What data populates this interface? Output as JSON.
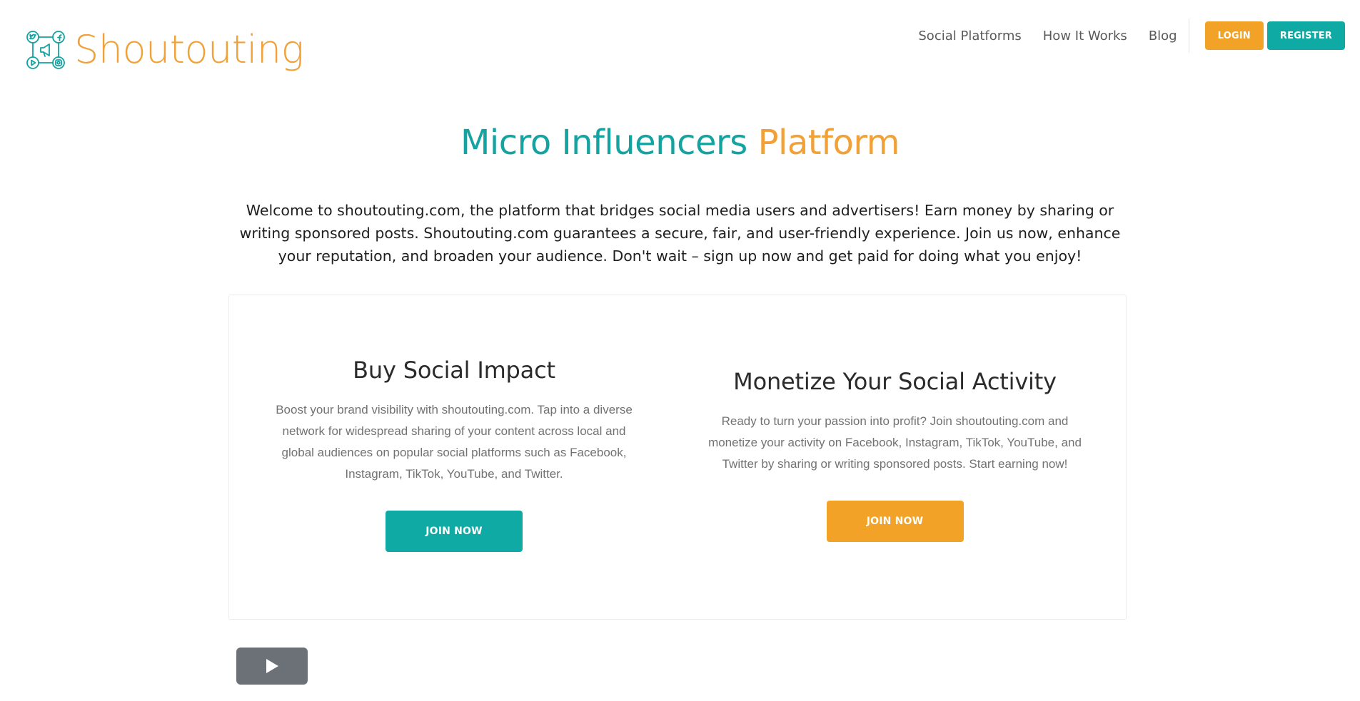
{
  "brand": {
    "name": "Shoutouting",
    "color": "#f0a137",
    "accent": "#14a3a0"
  },
  "nav": {
    "links": [
      "Social Platforms",
      "How It Works",
      "Blog"
    ],
    "login_label": "LOGIN",
    "register_label": "REGISTER"
  },
  "hero": {
    "title_part1": "Micro Influencers",
    "title_part2": "Platform",
    "intro": "Welcome to shoutouting.com, the platform that bridges social media users and advertisers! Earn money by sharing or writing sponsored posts. Shoutouting.com guarantees a secure, fair, and user-friendly experience. Join us now, enhance your reputation, and broaden your audience. Don't wait – sign up now and get paid for doing what you enjoy!"
  },
  "features": [
    {
      "title": "Buy Social Impact",
      "text": "Boost your brand visibility with shoutouting.com. Tap into a diverse network for widespread sharing of your content across local and global audiences on popular social platforms such as Facebook, Instagram, TikTok, YouTube, and Twitter.",
      "button": "JOIN NOW",
      "button_color": "#0faaa4"
    },
    {
      "title": "Monetize Your Social Activity",
      "text": "Ready to turn your passion into profit? Join shoutouting.com and monetize your activity on Facebook, Instagram, TikTok, YouTube, and Twitter by sharing or writing sponsored posts. Start earning now!",
      "button": "JOIN NOW",
      "button_color": "#f2a327"
    }
  ],
  "video": {
    "icon": "play-icon"
  }
}
